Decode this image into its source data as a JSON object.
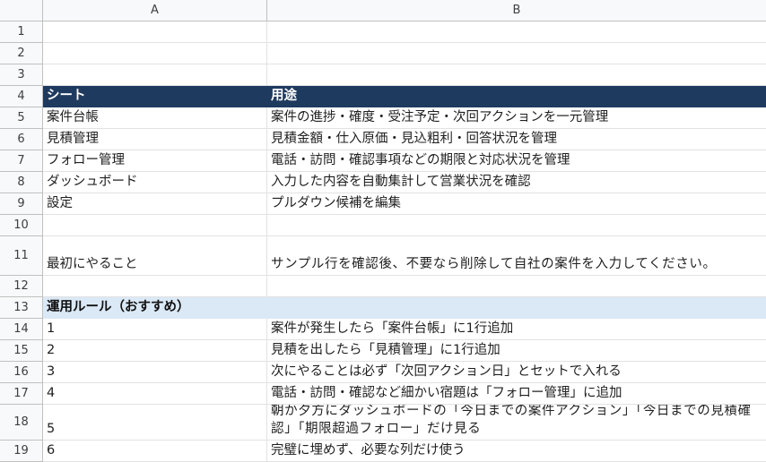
{
  "columns": [
    "A",
    "B"
  ],
  "rows": [
    {
      "num": "1",
      "a": "",
      "b": ""
    },
    {
      "num": "2",
      "a": "",
      "b": ""
    },
    {
      "num": "3",
      "a": "",
      "b": ""
    },
    {
      "num": "4",
      "a": "シート",
      "b": "用途"
    },
    {
      "num": "5",
      "a": "案件台帳",
      "b": "案件の進捗・確度・受注予定・次回アクションを一元管理"
    },
    {
      "num": "6",
      "a": "見積管理",
      "b": "見積金額・仕入原価・見込粗利・回答状況を管理"
    },
    {
      "num": "7",
      "a": "フォロー管理",
      "b": "電話・訪問・確認事項などの期限と対応状況を管理"
    },
    {
      "num": "8",
      "a": "ダッシュボード",
      "b": "入力した内容を自動集計して営業状況を確認"
    },
    {
      "num": "9",
      "a": "設定",
      "b": "プルダウン候補を編集"
    },
    {
      "num": "10",
      "a": "",
      "b": ""
    },
    {
      "num": "11",
      "a": "最初にやること",
      "b": "サンプル行を確認後、不要なら削除して自社の案件を入力してください。"
    },
    {
      "num": "12",
      "a": "",
      "b": ""
    },
    {
      "num": "13",
      "a": "運用ルール（おすすめ）",
      "b": ""
    },
    {
      "num": "14",
      "a": "1",
      "b": "案件が発生したら「案件台帳」に1行追加"
    },
    {
      "num": "15",
      "a": "2",
      "b": "見積を出したら「見積管理」に1行追加"
    },
    {
      "num": "16",
      "a": "3",
      "b": "次にやることは必ず「次回アクション日」とセットで入れる"
    },
    {
      "num": "17",
      "a": "4",
      "b": "電話・訪問・確認など細かい宿題は「フォロー管理」に追加"
    },
    {
      "num": "18",
      "a": "5",
      "b": "朝か夕方にダッシュボードの「今日までの案件アクション」「今日までの見積確認」「期限超過フォロー」だけ見る"
    },
    {
      "num": "19",
      "a": "6",
      "b": "完璧に埋めず、必要な列だけ使う"
    }
  ]
}
